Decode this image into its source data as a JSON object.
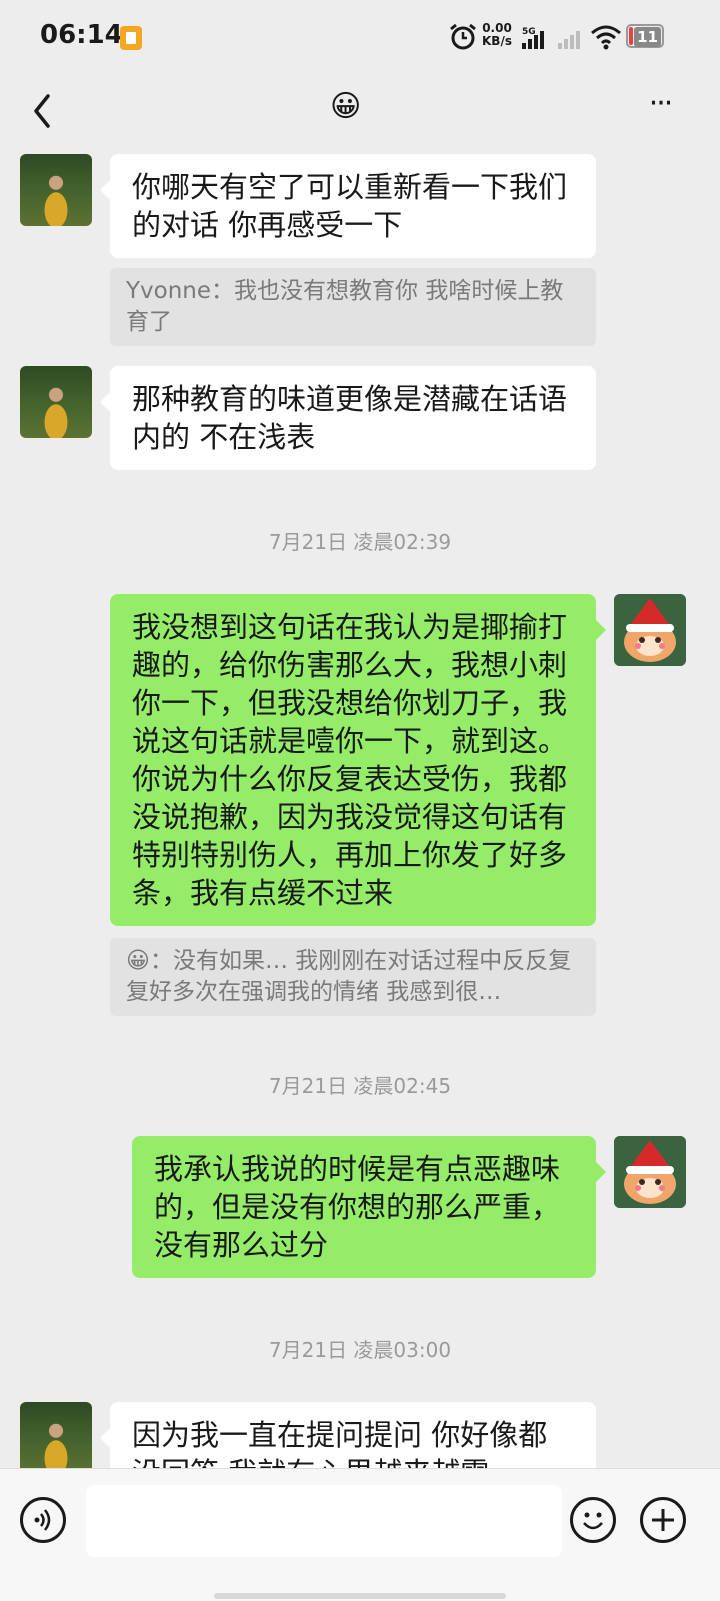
{
  "status_bar": {
    "time": "06:14",
    "net_speed_value": "0.00",
    "net_speed_unit": "KB/s",
    "signal_label": "5G",
    "battery": "11"
  },
  "header": {
    "title_emoji": "😀",
    "back_icon": "chevron-left-icon",
    "more_icon": "more-dots-icon",
    "more_label": "···"
  },
  "messages": [
    {
      "side": "in",
      "text": "你哪天有空了可以重新看一下我们的对话 你再感受一下"
    },
    {
      "quote": "Yvonne：我也没有想教育你  我啥时候上教育了"
    },
    {
      "side": "in",
      "text": "那种教育的味道更像是潜藏在话语内的 不在浅表"
    },
    {
      "timestamp": "7月21日 凌晨02:39"
    },
    {
      "side": "out",
      "text": "我没想到这句话在我认为是揶揄打趣的，给你伤害那么大，我想小刺你一下，但我没想给你划刀子，我说这句话就是噎你一下，就到这。 你说为什么你反复表达受伤，我都没说抱歉，因为我没觉得这句话有特别特别伤人，再加上你发了好多条，我有点缓不过来"
    },
    {
      "quote_emoji": "😀",
      "quote": "：没有如果… 我刚刚在对话过程中反反复复好多次在强调我的情绪 我感到很…"
    },
    {
      "timestamp": "7月21日 凌晨02:45"
    },
    {
      "side": "out",
      "text": "我承认我说的时候是有点恶趣味的，但是没有你想的那么严重，没有那么过分"
    },
    {
      "timestamp": "7月21日 凌晨03:00"
    },
    {
      "side": "in",
      "text": "因为我一直在提问提问 你好像都没回答 我就有心里越来越需"
    }
  ],
  "input_bar": {
    "voice_icon": "voice-icon",
    "emoji_icon": "emoji-icon",
    "plus_icon": "plus-icon",
    "input_value": ""
  }
}
